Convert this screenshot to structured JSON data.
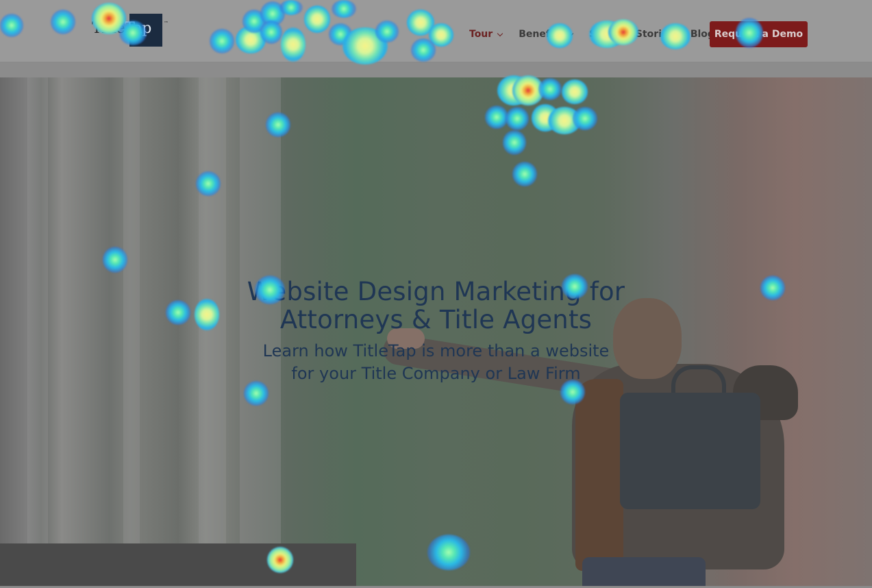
{
  "logo": {
    "text_title": "Title",
    "text_tap": "Tap",
    "tm": "™"
  },
  "nav": {
    "items": [
      {
        "label": "Tour",
        "has_dropdown": true,
        "active": true
      },
      {
        "label": "Benefits",
        "has_dropdown": true,
        "active": false
      },
      {
        "label": "Success Stories",
        "has_dropdown": false,
        "active": false
      },
      {
        "label": "Blog",
        "has_dropdown": false,
        "active": false
      }
    ],
    "cta_label": "Request a Demo"
  },
  "hero": {
    "title_line1": "Website Design Marketing for",
    "title_line2": "Attorneys & Title Agents",
    "subtitle_line1": "Learn how TitleTap is more than a website",
    "subtitle_line2": "for your Title Company or Law Firm"
  },
  "colors": {
    "accent_button": "#7d1b1b",
    "heading_text": "#1f3654",
    "nav_active": "#6b2222"
  }
}
